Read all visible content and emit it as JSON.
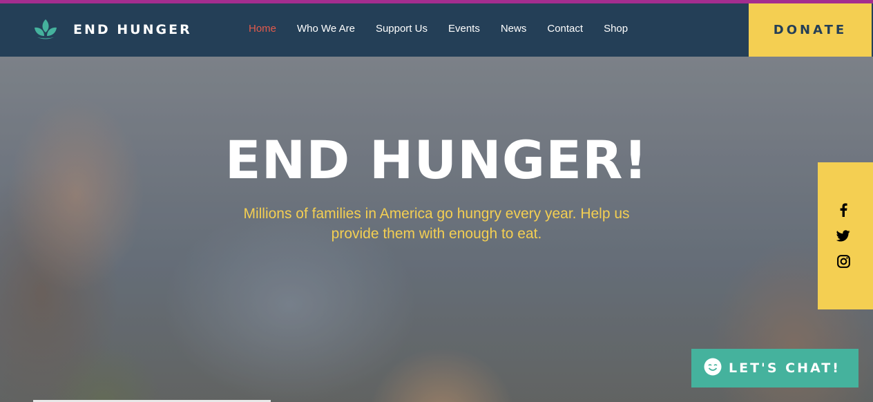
{
  "brand": {
    "name": "END HUNGER",
    "logo_icon": "leaf-sprout-icon",
    "color": "#45b29d"
  },
  "nav": {
    "items": [
      {
        "label": "Home",
        "active": true
      },
      {
        "label": "Who We Are",
        "active": false
      },
      {
        "label": "Support Us",
        "active": false
      },
      {
        "label": "Events",
        "active": false
      },
      {
        "label": "News",
        "active": false
      },
      {
        "label": "Contact",
        "active": false
      },
      {
        "label": "Shop",
        "active": false
      }
    ]
  },
  "donate": {
    "label": "DONATE"
  },
  "hero": {
    "title": "END HUNGER!",
    "subtitle": "Millions of families in America go hungry every year. Help us provide them with enough to eat."
  },
  "social": [
    {
      "icon": "facebook-icon"
    },
    {
      "icon": "twitter-icon"
    },
    {
      "icon": "instagram-icon"
    }
  ],
  "chat": {
    "label": "LET'S CHAT!",
    "icon": "smiley-icon"
  },
  "colors": {
    "navbar": "#243f57",
    "accent_yellow": "#f4cf52",
    "active_nav": "#e25a4c",
    "chat_green": "#45b29d",
    "top_stripe": "#a42d8f"
  }
}
